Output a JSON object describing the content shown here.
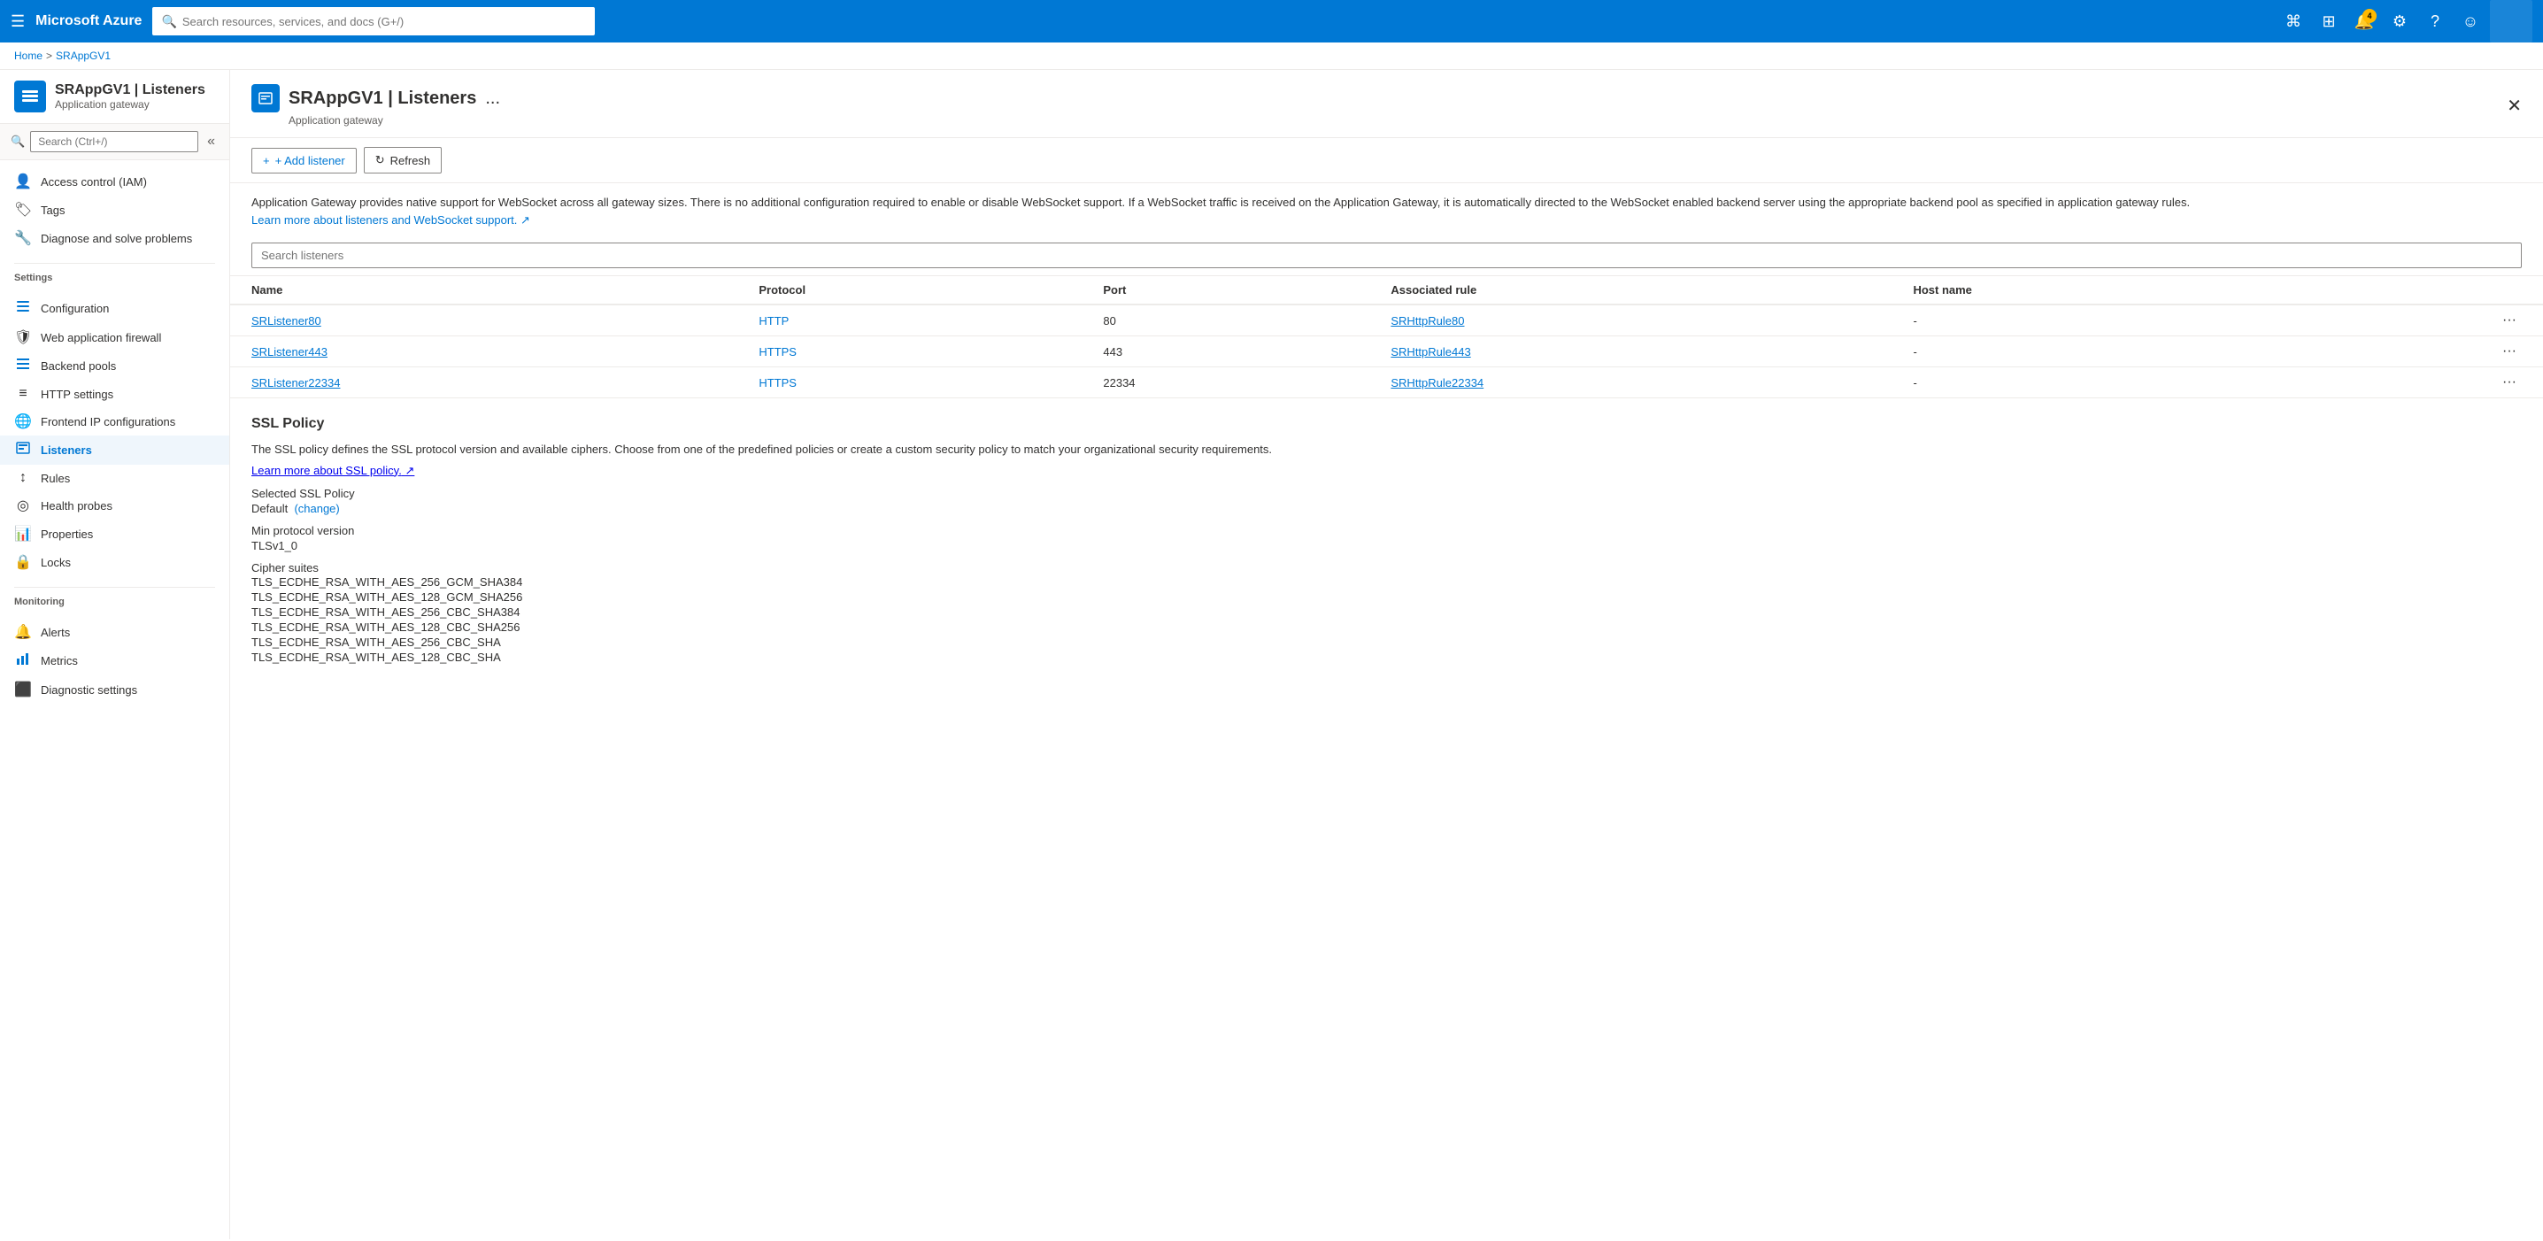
{
  "topNav": {
    "hamburger": "☰",
    "brand": "Microsoft Azure",
    "searchPlaceholder": "Search resources, services, and docs (G+/)",
    "icons": [
      {
        "name": "cloud-shell-icon",
        "symbol": "⌘",
        "badge": null
      },
      {
        "name": "portal-icon",
        "symbol": "⊞",
        "badge": null
      },
      {
        "name": "notifications-icon",
        "symbol": "🔔",
        "badge": "4"
      },
      {
        "name": "settings-icon",
        "symbol": "⚙",
        "badge": null
      },
      {
        "name": "help-icon",
        "symbol": "?",
        "badge": null
      },
      {
        "name": "feedback-icon",
        "symbol": "☺",
        "badge": null
      }
    ]
  },
  "breadcrumb": {
    "home": "Home",
    "separator1": ">",
    "resource": "SRAppGV1"
  },
  "resourceHeader": {
    "title": "SRAppGV1 | Listeners",
    "subtitle": "Application gateway",
    "moreLabel": "..."
  },
  "sidebar": {
    "searchPlaceholder": "Search (Ctrl+/)",
    "collapseIcon": "«",
    "navItems": [
      {
        "id": "access-control",
        "label": "Access control (IAM)",
        "icon": "👤",
        "active": false
      },
      {
        "id": "tags",
        "label": "Tags",
        "icon": "🏷",
        "active": false
      },
      {
        "id": "diagnose",
        "label": "Diagnose and solve problems",
        "icon": "🔧",
        "active": false
      }
    ],
    "settingsLabel": "Settings",
    "settingsItems": [
      {
        "id": "configuration",
        "label": "Configuration",
        "icon": "⚙",
        "active": false
      },
      {
        "id": "waf",
        "label": "Web application firewall",
        "icon": "🛡",
        "active": false
      },
      {
        "id": "backend-pools",
        "label": "Backend pools",
        "icon": "≡",
        "active": false
      },
      {
        "id": "http-settings",
        "label": "HTTP settings",
        "icon": "≡",
        "active": false
      },
      {
        "id": "frontend-ip",
        "label": "Frontend IP configurations",
        "icon": "🌐",
        "active": false
      },
      {
        "id": "listeners",
        "label": "Listeners",
        "icon": "📋",
        "active": true
      },
      {
        "id": "rules",
        "label": "Rules",
        "icon": "↕",
        "active": false
      },
      {
        "id": "health-probes",
        "label": "Health probes",
        "icon": "◎",
        "active": false
      },
      {
        "id": "properties",
        "label": "Properties",
        "icon": "📊",
        "active": false
      },
      {
        "id": "locks",
        "label": "Locks",
        "icon": "🔒",
        "active": false
      }
    ],
    "monitoringLabel": "Monitoring",
    "monitoringItems": [
      {
        "id": "alerts",
        "label": "Alerts",
        "icon": "🔔",
        "active": false
      },
      {
        "id": "metrics",
        "label": "Metrics",
        "icon": "📈",
        "active": false
      },
      {
        "id": "diagnostic-settings",
        "label": "Diagnostic settings",
        "icon": "🟢",
        "active": false
      }
    ]
  },
  "toolbar": {
    "addListenerLabel": "+ Add listener",
    "refreshLabel": "Refresh"
  },
  "infoText": {
    "paragraph": "Application Gateway provides native support for WebSocket across all gateway sizes. There is no additional configuration required to enable or disable WebSocket support. If a WebSocket traffic is received on the Application Gateway, it is automatically directed to the WebSocket enabled backend server using the appropriate backend pool as specified in application gateway rules.",
    "learnMoreLabel": "Learn more about listeners and WebSocket support.",
    "learnMoreIcon": "↗"
  },
  "searchListeners": {
    "placeholder": "Search listeners"
  },
  "table": {
    "columns": [
      "Name",
      "Protocol",
      "Port",
      "Associated rule",
      "Host name"
    ],
    "rows": [
      {
        "name": "SRListener80",
        "protocol": "HTTP",
        "port": "80",
        "associatedRule": "SRHttpRule80",
        "hostName": "-"
      },
      {
        "name": "SRListener443",
        "protocol": "HTTPS",
        "port": "443",
        "associatedRule": "SRHttpRule443",
        "hostName": "-"
      },
      {
        "name": "SRListener22334",
        "protocol": "HTTPS",
        "port": "22334",
        "associatedRule": "SRHttpRule22334",
        "hostName": "-"
      }
    ]
  },
  "sslPolicy": {
    "title": "SSL Policy",
    "description": "The SSL policy defines the SSL protocol version and available ciphers. Choose from one of the predefined policies or create a custom security policy to match your organizational security requirements.",
    "learnMoreLabel": "Learn more about SSL policy.",
    "learnMoreIcon": "↗",
    "selectedLabel": "Selected SSL Policy",
    "selectedValue": "Default",
    "changeLabel": "(change)",
    "minProtocolLabel": "Min protocol version",
    "minProtocolValue": "TLSv1_0",
    "cipherSuitesLabel": "Cipher suites",
    "cipherSuites": [
      "TLS_ECDHE_RSA_WITH_AES_256_GCM_SHA384",
      "TLS_ECDHE_RSA_WITH_AES_128_GCM_SHA256",
      "TLS_ECDHE_RSA_WITH_AES_256_CBC_SHA384",
      "TLS_ECDHE_RSA_WITH_AES_128_CBC_SHA256",
      "TLS_ECDHE_RSA_WITH_AES_256_CBC_SHA",
      "TLS_ECDHE_RSA_WITH_AES_128_CBC_SHA"
    ]
  }
}
